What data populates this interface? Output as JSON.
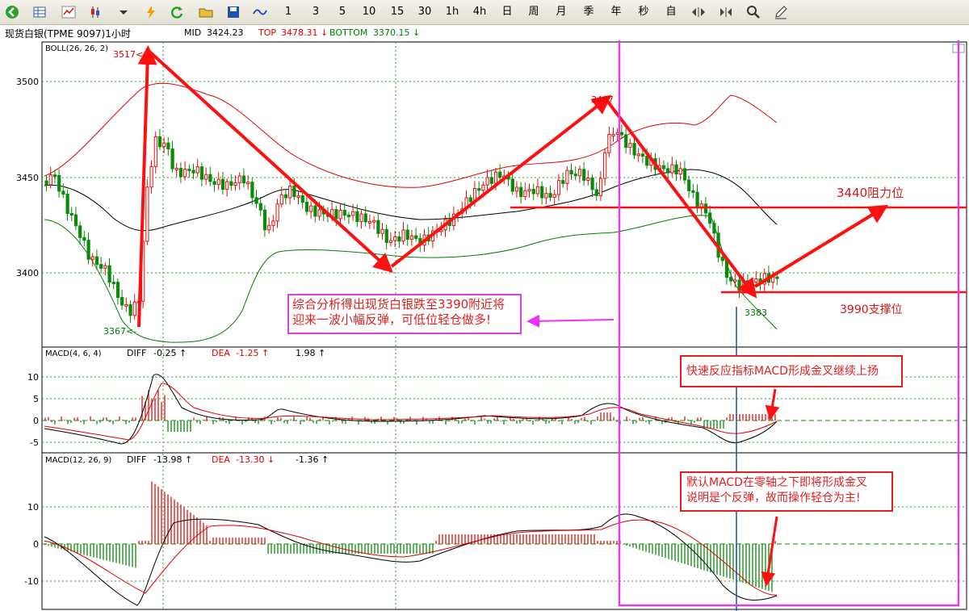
{
  "toolbar": {
    "periods": [
      "1",
      "3",
      "5",
      "10",
      "15",
      "30",
      "1h",
      "4h",
      "日",
      "周",
      "月",
      "季",
      "年",
      "秒",
      "自"
    ]
  },
  "header": {
    "instrument": "现货白银(TPME 9097)1小时",
    "mid_label": "MID",
    "mid_value": "3424.23",
    "top_label": "TOP",
    "top_value": "3478.31 ↓",
    "bottom_label": "BOTTOM",
    "bottom_value": "3370.15 ↓"
  },
  "main_panel": {
    "indicator": "BOLL(26, 26, 2)",
    "y_ticks": [
      "3500",
      "3450",
      "3400"
    ],
    "high_label": "3517<-",
    "low_label": "3367<-",
    "peak_label": "3487",
    "recent_low_label": "3383"
  },
  "macd1": {
    "title": "MACD(4, 6, 4)",
    "diff_label": "DIFF",
    "diff_value": "-0.25 ↑",
    "dea_label": "DEA",
    "dea_value": "-1.25 ↑",
    "macd_value": "1.98 ↑",
    "y_ticks": [
      "10",
      "5",
      "0",
      "-5"
    ]
  },
  "macd2": {
    "title": "MACD(12, 26, 9)",
    "diff_label": "DIFF",
    "diff_value": "-13.98 ↑",
    "dea_label": "DEA",
    "dea_value": "-13.30 ↓",
    "macd_value": "-1.36 ↑",
    "y_ticks": [
      "10",
      "0",
      "-10"
    ]
  },
  "annotations": {
    "analysis_line1": "综合分析得出现货白银跌至3390附近将",
    "analysis_line2": "迎来一波小幅反弹，可低位轻仓做多!",
    "resistance": "3440阻力位",
    "support": "3990支撑位",
    "macd_fast": "快速反应指标MACD形成金叉继续上扬",
    "macd_default_line1": "默认MACD在零轴之下即将形成金叉",
    "macd_default_line2": "说明是个反弹，故而操作轻仓为主!"
  },
  "colors": {
    "up": "#e01010",
    "down": "#0a8a0a",
    "mid": "#000000",
    "upper": "#e00000",
    "lower": "#008000",
    "annotation": "#e02020",
    "highlight": "#e040e0"
  }
}
